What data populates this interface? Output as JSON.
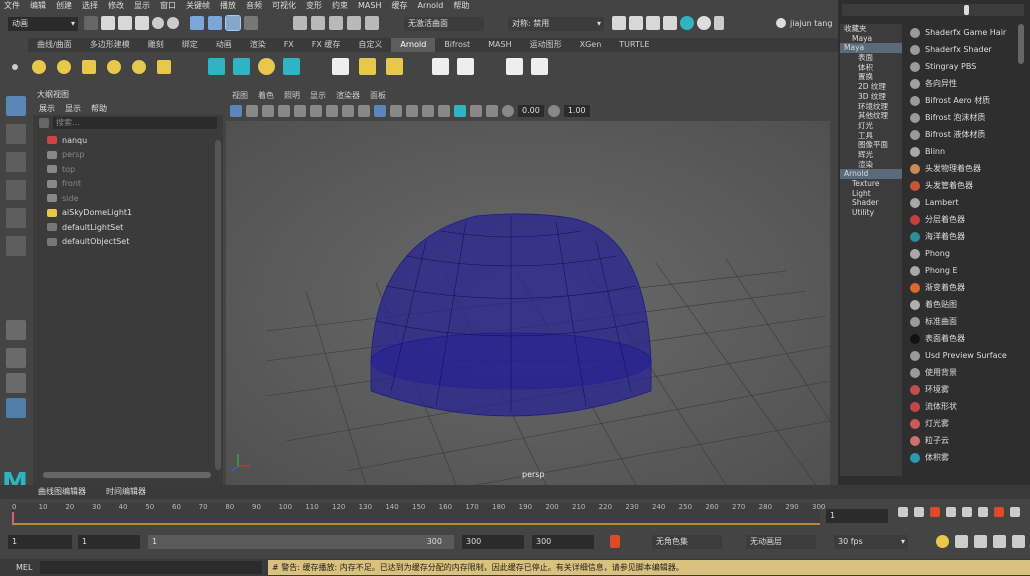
{
  "menubar": [
    "文件",
    "编辑",
    "创建",
    "选择",
    "修改",
    "显示",
    "窗口",
    "关键帧",
    "播放",
    "音频",
    "可视化",
    "变形",
    "约束",
    "MASH",
    "缓存",
    "Arnold",
    "帮助"
  ],
  "status": {
    "mode_select": "动画",
    "surface_select": "无激活曲面",
    "symmetry": "对称: 禁用",
    "user": "jiajun tang"
  },
  "shelf_tabs": [
    "曲线/曲面",
    "多边形建模",
    "雕刻",
    "绑定",
    "动画",
    "渲染",
    "FX",
    "FX 缓存",
    "自定义",
    "Arnold",
    "Bifrost",
    "MASH",
    "运动图形",
    "XGen",
    "TURTLE"
  ],
  "shelf_active": "Arnold",
  "outliner": {
    "title": "大纲视图",
    "menu": [
      "展示",
      "显示",
      "帮助"
    ],
    "search_placeholder": "搜索...",
    "items": [
      "nanqu",
      "persp",
      "top",
      "front",
      "side",
      "aiSkyDomeLight1",
      "defaultLightSet",
      "defaultObjectSet"
    ]
  },
  "viewport": {
    "menu": [
      "视图",
      "着色",
      "照明",
      "显示",
      "渲染器",
      "面板"
    ],
    "exposure": "0.00",
    "gamma": "1.00",
    "camera_label": "persp"
  },
  "hypershade_tree": {
    "items": [
      "收藏夹",
      "Maya",
      "Maya",
      "表面",
      "体积",
      "置换",
      "2D 纹理",
      "3D 纹理",
      "环境纹理",
      "其他纹理",
      "灯光",
      "工具",
      "图像平面",
      "辉光",
      "渲染",
      "Arnold",
      "Texture",
      "Light",
      "Shader",
      "Utility"
    ]
  },
  "hypershade_nodes": [
    {
      "label": "Shaderfx Game Hair",
      "color": "#9a9a9a"
    },
    {
      "label": "Shaderfx Shader",
      "color": "#9a9a9a"
    },
    {
      "label": "Stingray PBS",
      "color": "#9a9a9a"
    },
    {
      "label": "各向异性",
      "color": "#a0a0a0"
    },
    {
      "label": "Bifrost Aero 材质",
      "color": "#9a9a9a"
    },
    {
      "label": "Bifrost 泡沫材质",
      "color": "#9a9a9a"
    },
    {
      "label": "Bifrost 液体材质",
      "color": "#9a9a9a"
    },
    {
      "label": "Blinn",
      "color": "#a8a8a8"
    },
    {
      "label": "头发物理着色器",
      "color": "#c88b5a"
    },
    {
      "label": "头发管着色器",
      "color": "#c4563a"
    },
    {
      "label": "Lambert",
      "color": "#a8a8a8"
    },
    {
      "label": "分层着色器",
      "color": "#c44040"
    },
    {
      "label": "海洋着色器",
      "color": "#2a8f9a"
    },
    {
      "label": "Phong",
      "color": "#a8a8a8"
    },
    {
      "label": "Phong E",
      "color": "#a8a8a8"
    },
    {
      "label": "渐变着色器",
      "color": "#d86a2a"
    },
    {
      "label": "着色贴图",
      "color": "#b0b0b0"
    },
    {
      "label": "标准曲面",
      "color": "#9a9a9a"
    },
    {
      "label": "表面着色器",
      "color": "#111111"
    },
    {
      "label": "Usd Preview Surface",
      "color": "#9a9a9a"
    },
    {
      "label": "使用背景",
      "color": "#9a9a9a"
    },
    {
      "label": "环境雾",
      "color": "#c05050"
    },
    {
      "label": "流体形状",
      "color": "#c04848"
    },
    {
      "label": "灯光雾",
      "color": "#c85a5a"
    },
    {
      "label": "粒子云",
      "color": "#d07070"
    },
    {
      "label": "体积雾",
      "color": "#2a9ab0"
    }
  ],
  "timeline": {
    "tabs": [
      "曲线图编辑器",
      "时间编辑器"
    ],
    "ticks": [
      "0",
      "10",
      "20",
      "30",
      "40",
      "50",
      "60",
      "70",
      "80",
      "90",
      "100",
      "110",
      "120",
      "130",
      "140",
      "150",
      "160",
      "170",
      "180",
      "190",
      "200",
      "210",
      "220",
      "230",
      "240",
      "250",
      "260",
      "270",
      "280",
      "290",
      "300"
    ],
    "current_frame": "1",
    "start_frame": "1",
    "playback_start": "1",
    "range_slider_start": "1",
    "range_slider_end": "300",
    "playback_end": "300",
    "end_frame": "300",
    "character_set": "无角色集",
    "anim_layer": "无动画层",
    "fps": "30 fps"
  },
  "command_line": {
    "label": "MEL",
    "warning": "# 警告: 缓存播放: 内存不足。已达到为缓存分配的内存限制，因此缓存已停止。有关详细信息，请参见脚本编辑器。"
  },
  "logo_letter": "M"
}
